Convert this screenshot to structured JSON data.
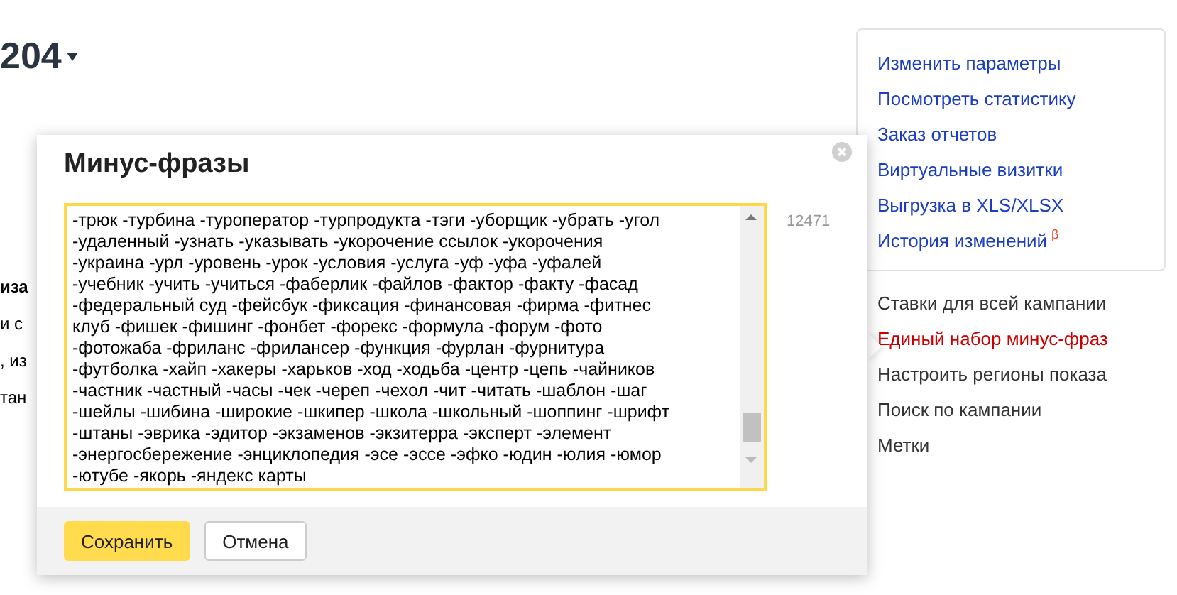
{
  "page": {
    "heading": "204",
    "background_fragments": [
      {
        "text": "иза",
        "bold": true
      },
      {
        "text": "и с",
        "bold": false
      },
      {
        "text": ", из",
        "bold": false
      },
      {
        "text": "тан",
        "bold": false
      }
    ]
  },
  "actions_card": {
    "links": [
      {
        "label": "Изменить параметры"
      },
      {
        "label": "Посмотреть статистику"
      },
      {
        "label": "Заказ отчетов"
      },
      {
        "label": "Виртуальные визитки"
      },
      {
        "label": "Выгрузка в XLS/XLSX"
      },
      {
        "label": "История изменений",
        "beta_mark": "β"
      }
    ]
  },
  "settings_menu": [
    {
      "label": "Ставки для всей кампании",
      "selected": false
    },
    {
      "label": "Единый набор минус-фраз",
      "selected": true
    },
    {
      "label": "Настроить регионы показа",
      "selected": false
    },
    {
      "label": "Поиск по кампании",
      "selected": false
    },
    {
      "label": "Метки",
      "selected": false
    }
  ],
  "dialog": {
    "title": "Минус-фразы",
    "counter": "12471",
    "phrases_lines": [
      "-трюк -турбина -туроператор -турпродукта -тэги -уборщик -убрать -угол",
      "-удаленный -узнать -указывать -укорочение ссылок -укорочения",
      "-украина -урл -уровень -урок -условия -услуга -уф -уфа -уфалей",
      "-учебник -учить -учиться -фаберлик -файлов -фактор -факту -фасад",
      "-федеральный суд -фейсбук -фиксация -финансовая -фирма -фитнес",
      "клуб -фишек -фишинг -фонбет -форекс -формула -форум -фото",
      "-фотожаба -фриланс -фрилансер -функция -фурлан -фурнитура",
      "-футболка -хайп -хакеры -харьков -ход -ходьба -центр -цепь -чайников",
      "-частник -частный -часы -чек -череп -чехол -чит -читать -шаблон -шаг",
      "-шейлы -шибина -широкие -шкипер -школа -школьный -шоппинг -шрифт",
      "-штаны -эврика -эдитор -экзаменов -экзитерра -эксперт -элемент",
      "-энергосбережение -энциклопедия -эсе -эссе -эфко -юдин -юлия -юмор",
      "-ютубе -якорь -яндекс карты"
    ],
    "buttons": [
      {
        "label": "Сохранить",
        "kind": "primary"
      },
      {
        "label": "Отмена",
        "kind": "secondary"
      }
    ]
  }
}
